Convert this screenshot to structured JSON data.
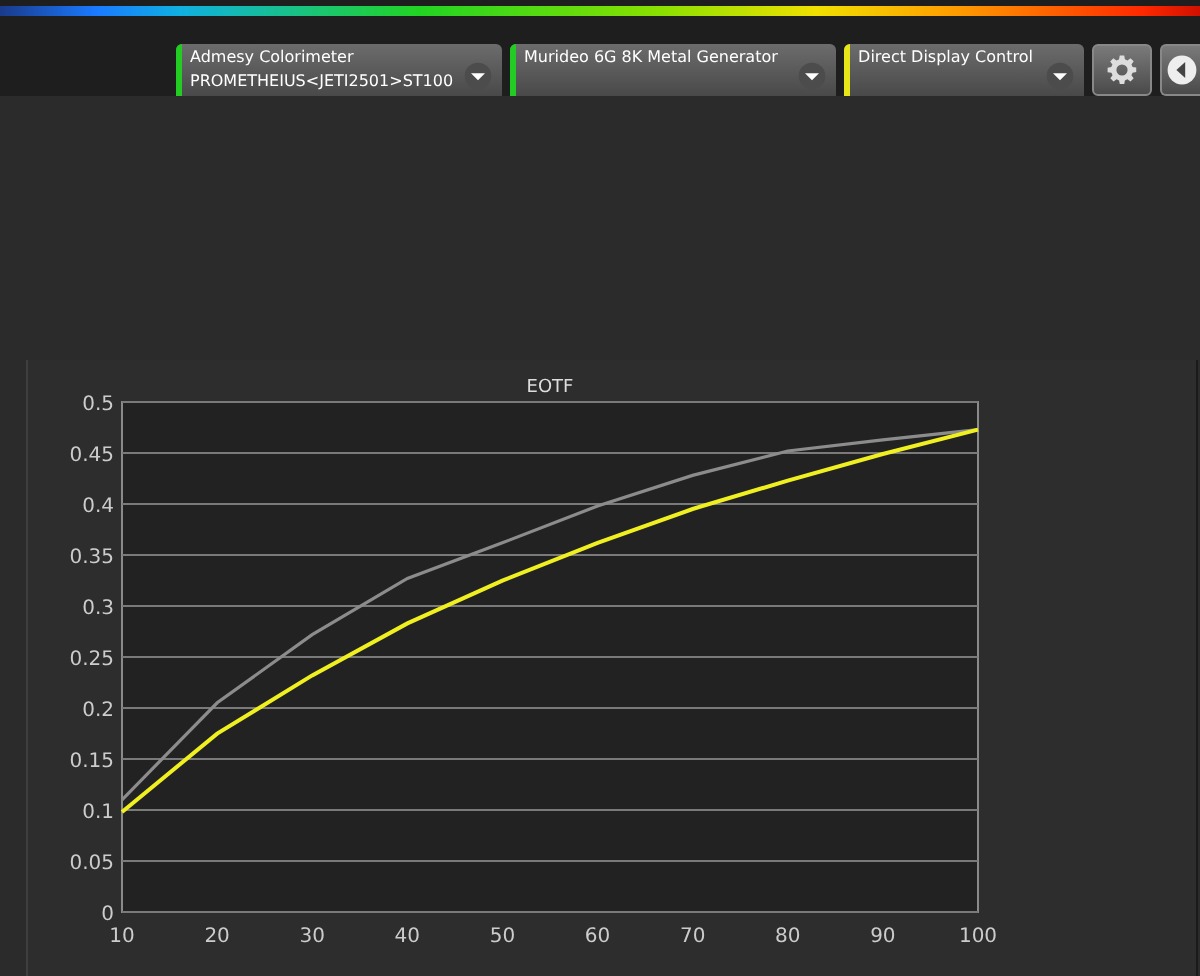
{
  "devices": [
    {
      "lines": [
        "Admesy Colorimeter",
        "PROMETHEIUS<JETI2501>ST100"
      ],
      "color": "#22cc22"
    },
    {
      "lines": [
        "Murideo 6G 8K Metal Generator"
      ],
      "color": "#22cc22"
    },
    {
      "lines": [
        "Direct Display Control"
      ],
      "color": "#e6e619"
    }
  ],
  "chart": {
    "chart_data": {
      "type": "line",
      "title": "EOTF",
      "x": [
        10,
        20,
        30,
        40,
        50,
        60,
        70,
        80,
        90,
        100
      ],
      "series": [
        {
          "color": "#8c8c8c",
          "values": [
            0.11,
            0.205,
            0.272,
            0.327,
            0.362,
            0.398,
            0.428,
            0.452,
            0.463,
            0.473
          ]
        },
        {
          "color": "#f0f020",
          "values": [
            0.098,
            0.175,
            0.232,
            0.283,
            0.325,
            0.362,
            0.395,
            0.423,
            0.449,
            0.473
          ]
        }
      ],
      "grid": true,
      "xlim": [
        10,
        100
      ],
      "ylim": [
        0,
        0.5
      ],
      "xticks": [
        10,
        20,
        30,
        40,
        50,
        60,
        70,
        80,
        90,
        100
      ],
      "yticks": [
        0,
        {
          "value": 0.05,
          "label": "0.05"
        },
        {
          "value": 0.1,
          "label": "0.1"
        },
        {
          "value": 0.15,
          "label": "0.15"
        },
        {
          "value": 0.2,
          "label": "0.2"
        },
        {
          "value": 0.25,
          "label": "0.25"
        },
        {
          "value": 0.3,
          "label": "0.3"
        },
        {
          "value": 0.35,
          "label": "0.35"
        },
        {
          "value": 0.4,
          "label": "0.4"
        },
        {
          "value": 0.45,
          "label": "0.45"
        },
        {
          "value": 0.5,
          "label": "0.5"
        }
      ]
    }
  }
}
